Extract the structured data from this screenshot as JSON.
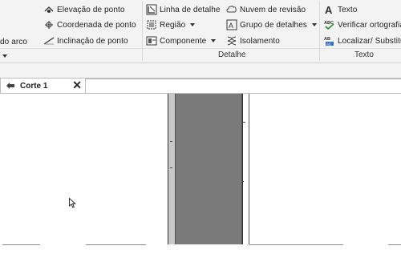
{
  "ribbon": {
    "col0": {
      "arc_label": "do arco"
    },
    "col1": {
      "items": [
        {
          "label": "Elevação  de ponto",
          "icon": "spot-elevation-icon"
        },
        {
          "label": "Coordenada  de ponto",
          "icon": "spot-coordinate-icon"
        },
        {
          "label": "Inclinação  de ponto",
          "icon": "spot-slope-icon"
        }
      ]
    },
    "detalhe": {
      "panel_label": "Detalhe",
      "left_items": [
        {
          "label": "Linha de  detalhe",
          "icon": "detail-line-icon"
        },
        {
          "label": "Região",
          "icon": "region-icon"
        },
        {
          "label": "Componente",
          "icon": "component-icon"
        }
      ],
      "right_items": [
        {
          "label": "Nuvem de  revisão",
          "icon": "revision-cloud-icon"
        },
        {
          "label": "Grupo de detalhes",
          "icon": "detail-group-icon"
        },
        {
          "label": "Isolamento",
          "icon": "insulation-icon"
        }
      ]
    },
    "texto": {
      "panel_label": "Texto",
      "items": [
        {
          "label": "Texto",
          "icon": "text-icon"
        },
        {
          "label": "Verificar  ortografia",
          "icon": "spelling-icon"
        },
        {
          "label": "Localizar/  Substituir",
          "icon": "find-replace-icon"
        }
      ]
    }
  },
  "tab": {
    "label": "Corte 1",
    "close": "✕"
  }
}
